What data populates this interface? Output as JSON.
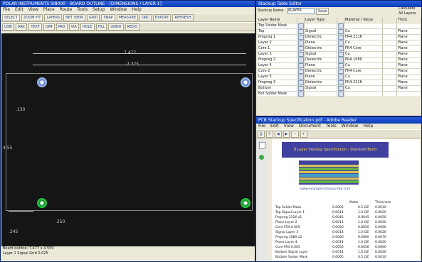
{
  "cad": {
    "title": "POLAR INSTRUMENTS SI8000 - BOARD OUTLINE - [DIMENSIONS / LAYER 1]",
    "menu": [
      "File",
      "Edit",
      "View",
      "Place",
      "Route",
      "Tools",
      "Setup",
      "Window",
      "Help"
    ],
    "toolbar_row1": [
      "SELECT",
      "ZOOM FIT",
      "LAYERS",
      "NET VIEW",
      "GRID",
      "SNAP",
      "MEASURE",
      "DRC",
      "EXPORT",
      "REFRESH"
    ],
    "toolbar_row2": [
      "LINE",
      "ARC",
      "TEXT",
      "DIM",
      "PAD",
      "VIA",
      "HOLE",
      "FILL",
      "UNDO",
      "REDO"
    ],
    "dims": {
      "top1": "7.477",
      "top2": "7.375",
      "left_small": ".130",
      "left_mid": "4.55",
      "bottom_left": ".245",
      "bottom_mid": ".250"
    },
    "status": [
      "Board outline: 7.477 x 4.550",
      "Layer 1 Signal    Grid 0.025"
    ]
  },
  "table_editor": {
    "title": "Stackup Table Editor",
    "label_stack": "Stackup Name",
    "stack_value": "8LAYER",
    "btn": "Save",
    "right_label": "Calculate",
    "right_label2": "All Layers",
    "headers": [
      "Layer Name",
      "",
      "Layer Type",
      "",
      "Material / Value",
      "",
      "Thick"
    ],
    "rows": [
      [
        "Top Solder Mask",
        "",
        "",
        "",
        "",
        "",
        ""
      ],
      [
        "Top",
        "",
        "Signal",
        "",
        "Cu",
        "",
        "Plane"
      ],
      [
        "Prepreg 1",
        "",
        "Dielectric",
        "",
        "FR4 2116",
        "",
        "Plane"
      ],
      [
        "Layer 2",
        "",
        "Plane",
        "",
        "Cu",
        "",
        "Plane"
      ],
      [
        "Core 1",
        "",
        "Dielectric",
        "",
        "FR4 Core",
        "",
        "Plane"
      ],
      [
        "Layer 3",
        "",
        "Signal",
        "",
        "Cu",
        "",
        "Plane"
      ],
      [
        "Prepreg 2",
        "",
        "Dielectric",
        "",
        "FR4 1080",
        "",
        "Plane"
      ],
      [
        "Layer 4",
        "",
        "Plane",
        "",
        "Cu",
        "",
        "Plane"
      ],
      [
        "Core 2",
        "",
        "Dielectric",
        "",
        "FR4 Core",
        "",
        "Plane"
      ],
      [
        "Layer 5",
        "",
        "Plane",
        "",
        "Cu",
        "",
        "Plane"
      ],
      [
        "Prepreg 3",
        "",
        "Dielectric",
        "",
        "FR4 2116",
        "",
        "Plane"
      ],
      [
        "Bottom",
        "",
        "Signal",
        "",
        "Cu",
        "",
        "Plane"
      ],
      [
        "Bot Solder Mask",
        "",
        "",
        "",
        "",
        "",
        ""
      ]
    ]
  },
  "pdf": {
    "title": "PCB Stackup Specification.pdf - Adobe Reader",
    "menu": [
      "File",
      "Edit",
      "View",
      "Document",
      "Tools",
      "Window",
      "Help"
    ],
    "page_title": "8 Layer Stackup Specification - Standard Build",
    "footer_caption": "www.example-stackup-fab.com",
    "spec_headers": [
      "",
      "",
      "",
      "Material",
      "",
      "Thickness"
    ],
    "spec_rows": [
      [
        "Top Solder Mask",
        "",
        "0.0005",
        "",
        "0.5 OZ",
        "0.0010"
      ],
      [
        "Top Signal Layer 1",
        "",
        "0.0014",
        "",
        "1.0 OZ",
        "0.0020"
      ],
      [
        "Prepreg 2116 x1",
        "",
        "0.0045",
        "",
        "0.0045",
        "0.0050"
      ],
      [
        "Plane Layer 2",
        "",
        "0.0014",
        "",
        "1.0 OZ",
        "0.0020"
      ],
      [
        "Core FR4 0.005",
        "",
        "0.0050",
        "",
        "0.0050",
        "0.0060"
      ],
      [
        "Signal Layer 3",
        "",
        "0.0014",
        "",
        "1.0 OZ",
        "0.0020"
      ],
      [
        "Prepreg 1080 x2",
        "",
        "0.0060",
        "",
        "0.0060",
        "0.0070"
      ],
      [
        "Plane Layer 4",
        "",
        "0.0014",
        "",
        "1.0 OZ",
        "0.0020"
      ],
      [
        "Core FR4 0.005",
        "",
        "0.0050",
        "",
        "0.0050",
        "0.0060"
      ],
      [
        "Bottom Signal Layer",
        "",
        "0.0014",
        "",
        "1.0 OZ",
        "0.0020"
      ],
      [
        "Bottom Solder Mask",
        "",
        "0.0005",
        "",
        "0.5 OZ",
        "0.0010"
      ]
    ]
  },
  "colors": {
    "canvas_bg": "#151515",
    "hole_blue": "#9ab7e6",
    "hole_green": "#22c640",
    "pdf_banner": "#4040a0"
  }
}
